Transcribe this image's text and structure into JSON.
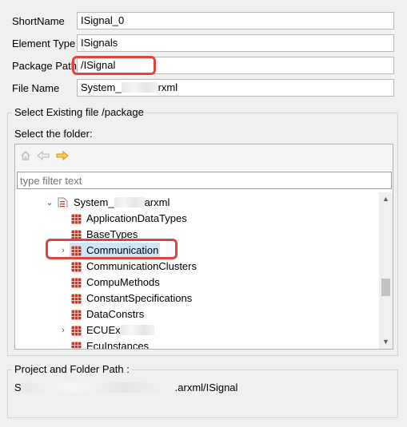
{
  "form": {
    "shortname_label": "ShortName",
    "shortname_value": "ISignal_0",
    "element_type_label": "Element Type",
    "element_type_value": "ISignals",
    "package_path_label": "Package Path",
    "package_path_value": "/ISignal",
    "file_name_label": "File Name",
    "file_name_prefix": "System_",
    "file_name_suffix": "rxml"
  },
  "select_group": {
    "title": "Select Existing file /package",
    "folder_label": "Select the folder:",
    "filter_placeholder": "type filter text"
  },
  "tree": {
    "root": {
      "label_prefix": "System_",
      "label_suffix": "arxml"
    },
    "items": [
      {
        "label": "ApplicationDataTypes"
      },
      {
        "label": "BaseTypes"
      },
      {
        "label": "Communication"
      },
      {
        "label": "CommunicationClusters"
      },
      {
        "label": "CompuMethods"
      },
      {
        "label": "ConstantSpecifications"
      },
      {
        "label": "DataConstrs"
      },
      {
        "label": "ECUEx"
      },
      {
        "label": "EcuInstances"
      }
    ]
  },
  "path_group": {
    "title": "Project and Folder Path :",
    "path_prefix": "S",
    "path_suffix": ".arxml/ISignal"
  },
  "colors": {
    "highlight": "#e0443d",
    "selection": "#cfe5f8",
    "package_icon": "#c0392b"
  }
}
